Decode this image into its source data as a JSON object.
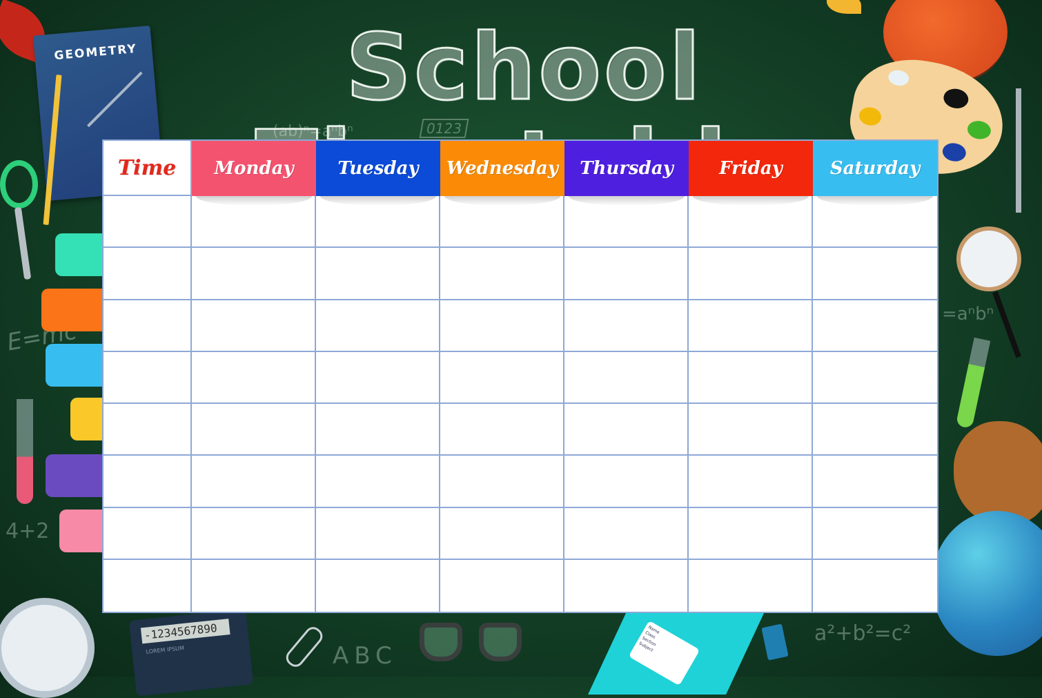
{
  "title": "School Timetable",
  "header": {
    "time_label": "Time",
    "days": [
      {
        "label": "Monday",
        "color": "#f4536f"
      },
      {
        "label": "Tuesday",
        "color": "#0b4bd8"
      },
      {
        "label": "Wednesday",
        "color": "#fb8b07"
      },
      {
        "label": "Thursday",
        "color": "#4f1fe0"
      },
      {
        "label": "Friday",
        "color": "#f3270c"
      },
      {
        "label": "Saturday",
        "color": "#38bdf0"
      }
    ],
    "time_color": "#e3281b"
  },
  "rows": 8,
  "side_tabs": [
    "#34e0b5",
    "#fb7418",
    "#38bdf0",
    "#fbc82a",
    "#6a4cc0",
    "#f78aa6"
  ],
  "decor_text": {
    "book_title": "GEOMETRY",
    "calculator_display": "-1234567890",
    "calculator_label": "LOREM IPSUM",
    "chalk_formula_1": "E=mc",
    "chalk_formula_2": "4+2",
    "chalk_formula_3": "(ab)ⁿ=aⁿbⁿ",
    "chalk_formula_4": "a²+b²=c²",
    "chalk_formula_5": "=aⁿbⁿ",
    "chalk_letters": "ABC",
    "chalk_clock": "0123",
    "notebook_fields": [
      "Name",
      "Class",
      "Section",
      "Subject"
    ]
  }
}
